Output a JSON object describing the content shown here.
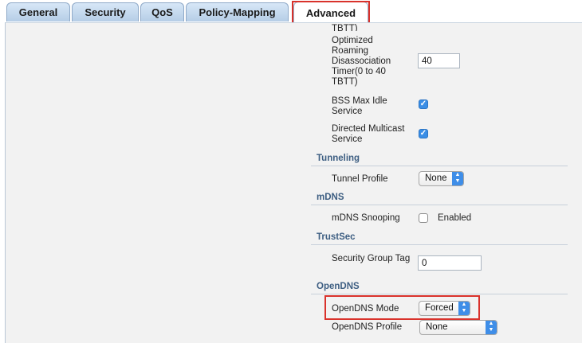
{
  "tabs": [
    "General",
    "Security",
    "QoS",
    "Policy-Mapping",
    "Advanced"
  ],
  "fields": {
    "cut_label": "TBTT)",
    "disassoc_label": "Optimized Roaming Disassociation Timer(0 to 40 TBTT)",
    "disassoc_value": "40",
    "bss_label": "BSS Max Idle Service",
    "multicast_label": "Directed Multicast Service",
    "tunneling_heading": "Tunneling",
    "tunnel_profile_label": "Tunnel Profile",
    "tunnel_profile_value": "None",
    "mdns_heading": "mDNS",
    "mdns_snooping_label": "mDNS Snooping",
    "mdns_enabled_label": "Enabled",
    "trustsec_heading": "TrustSec",
    "sgt_label": "Security Group Tag",
    "sgt_value": "0",
    "opendns_heading": "OpenDNS",
    "opendns_mode_label": "OpenDNS Mode",
    "opendns_mode_value": "Forced",
    "opendns_profile_label": "OpenDNS Profile",
    "opendns_profile_value": "None"
  },
  "checkboxes": {
    "bss_max_idle": true,
    "directed_multicast": true,
    "mdns_snooping": false
  },
  "colors": {
    "highlight": "#d9322b",
    "section_heading": "#3d5e82",
    "accent": "#3f8ee8"
  }
}
